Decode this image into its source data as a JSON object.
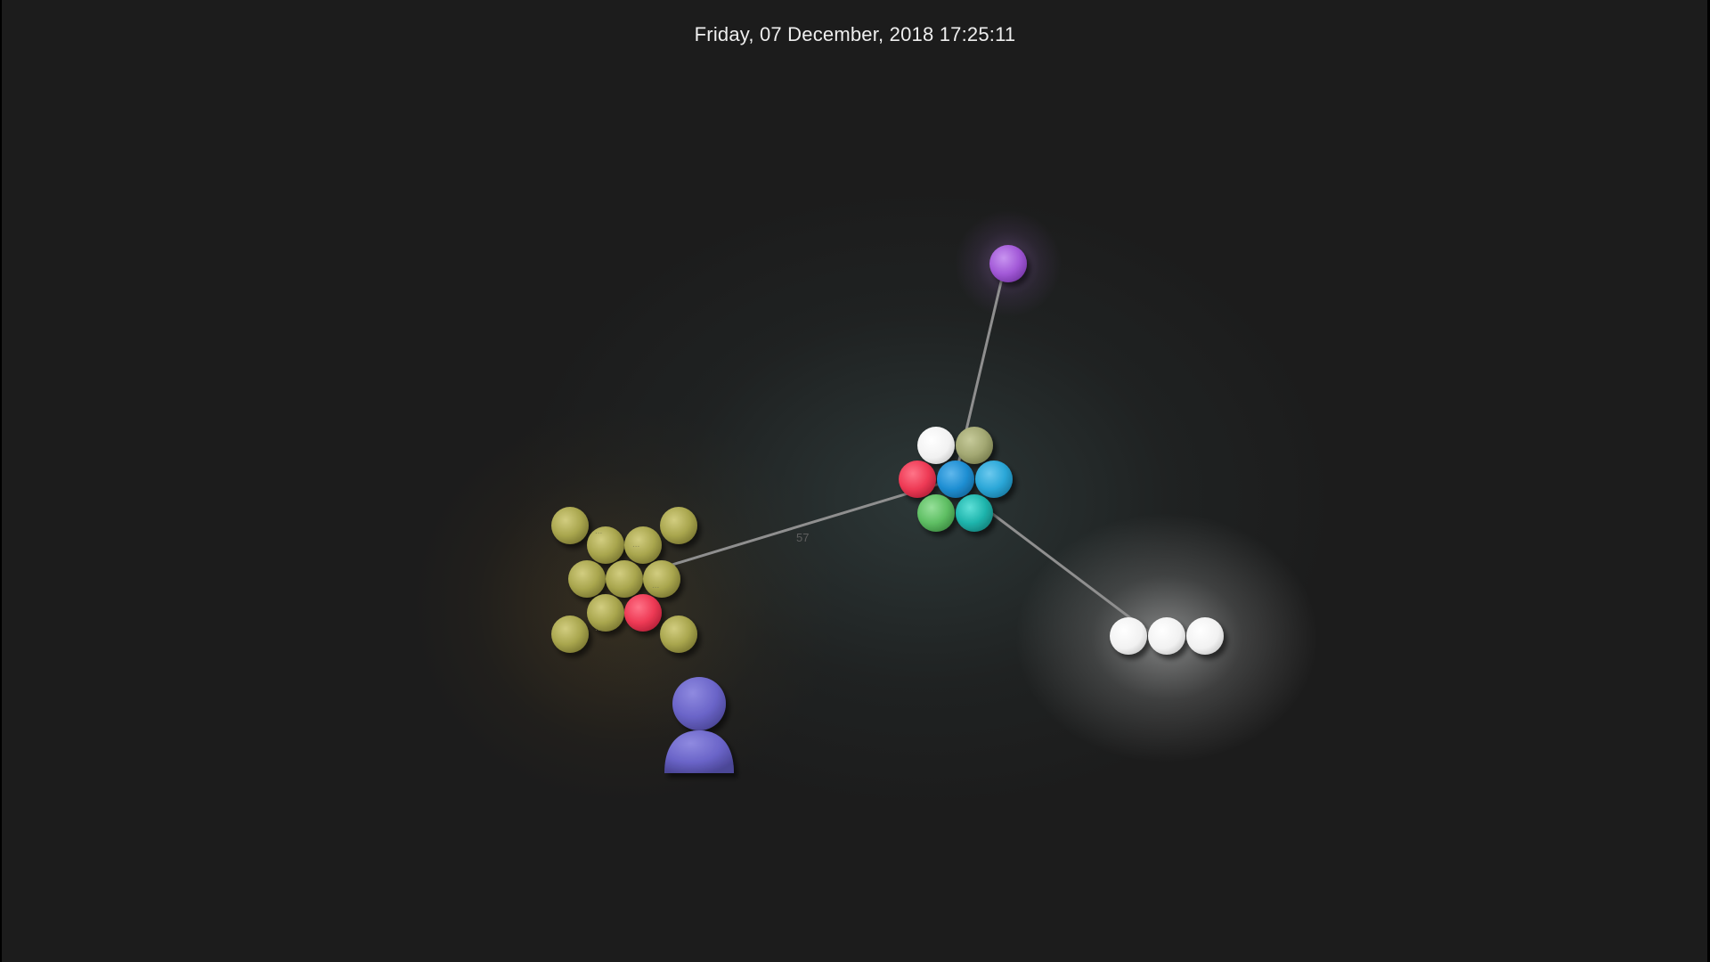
{
  "header": {
    "datetime": "Friday, 07 December, 2018 17:25:11"
  },
  "colors": {
    "background": "#1c1c1c",
    "edge": "#8c8c8c",
    "olive": "#a9a64e",
    "olive_light": "#b8b35e",
    "sage": "#a3a873",
    "red": "#ee3a55",
    "blue": "#1f8fd3",
    "sky": "#2ba7d8",
    "teal": "#1fb5ad",
    "green": "#5fbf64",
    "white": "#f4f4f4",
    "purple": "#a35ad8",
    "person": "#6a64c8"
  },
  "graph": {
    "edge_labels": {
      "hub_to_cluster": "57"
    },
    "cluster_labels": [
      "...",
      "...",
      "...",
      "..."
    ]
  }
}
